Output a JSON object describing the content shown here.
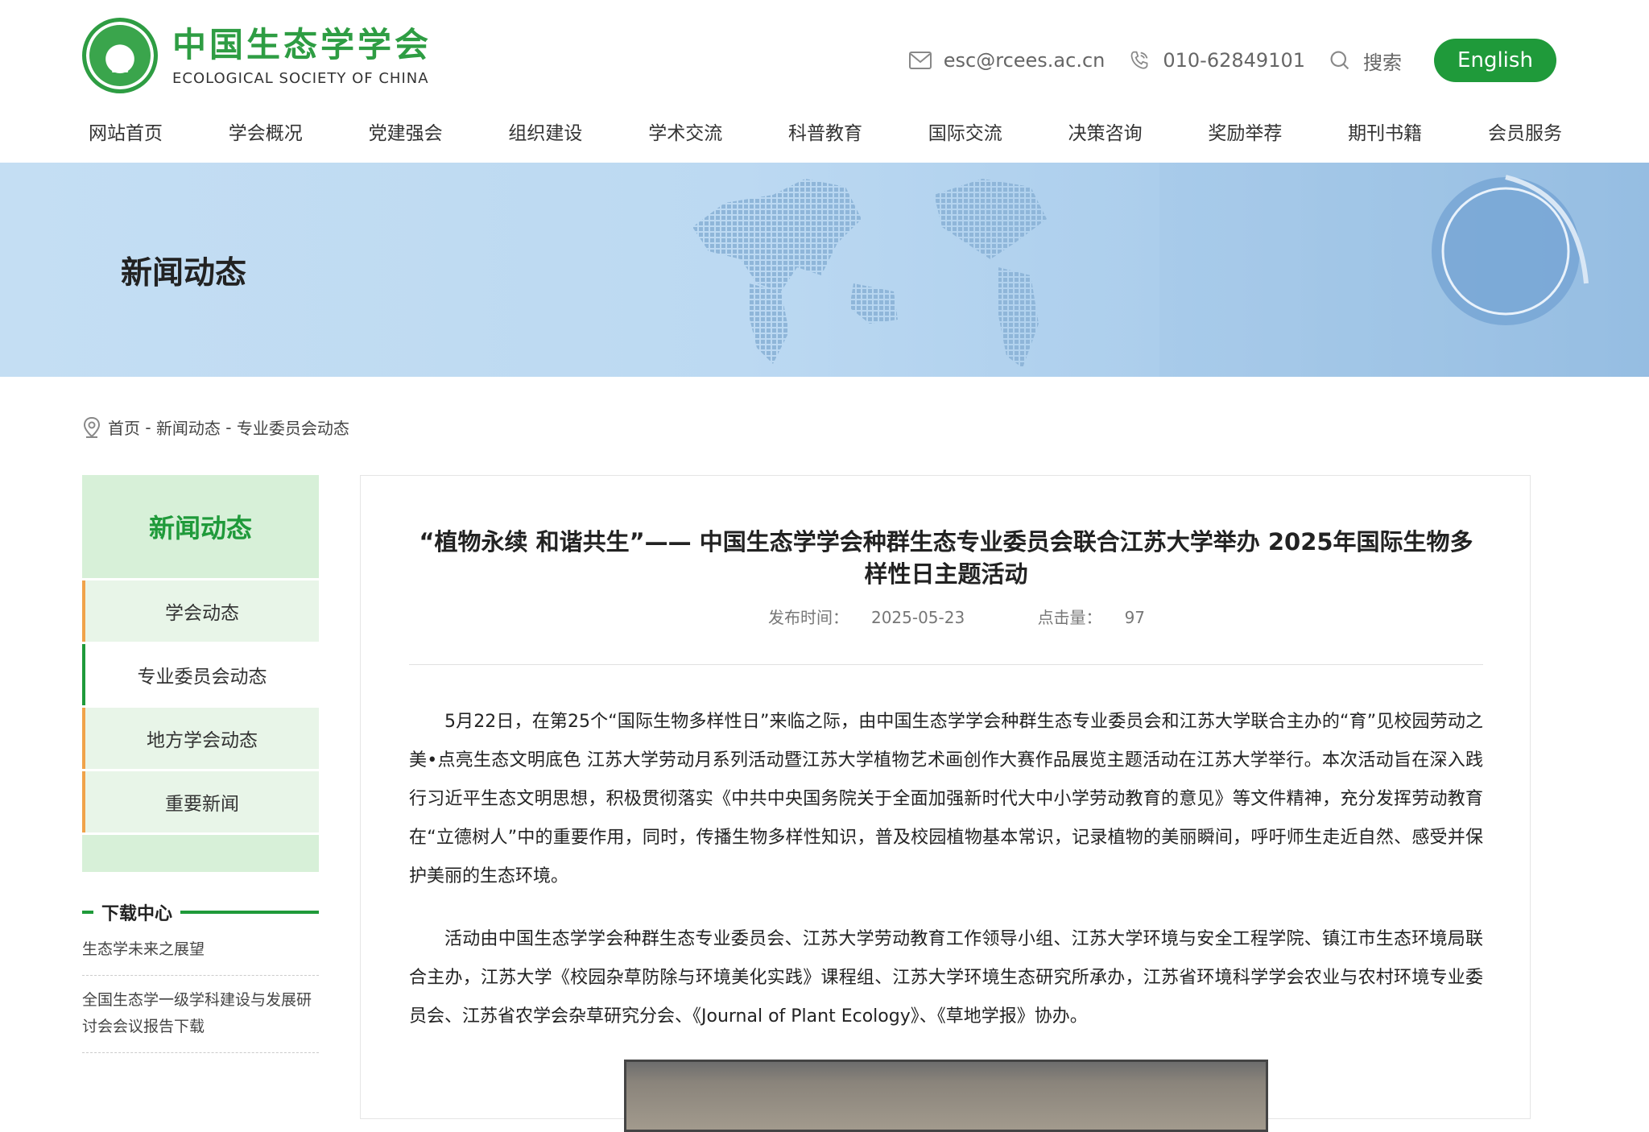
{
  "header": {
    "logo_cn": "中国生态学学会",
    "logo_en": "ECOLOGICAL SOCIETY OF CHINA",
    "logo_badge": "ESC",
    "email": "esc@rcees.ac.cn",
    "phone": "010-62849101",
    "search_label": "搜索",
    "english_label": "English",
    "accent_color": "#1f9a3a"
  },
  "nav": [
    "网站首页",
    "学会概况",
    "党建强会",
    "组织建设",
    "学术交流",
    "科普教育",
    "国际交流",
    "决策咨询",
    "奖励举荐",
    "期刊书籍",
    "会员服务"
  ],
  "banner": {
    "title": "新闻动态"
  },
  "breadcrumb": {
    "home": "首页",
    "sep": " - ",
    "level1": "新闻动态",
    "level2": "专业委员会动态"
  },
  "sidebar": {
    "title": "新闻动态",
    "items": [
      "学会动态",
      "专业委员会动态",
      "地方学会动态",
      "重要新闻"
    ],
    "active_item": "专业委员会动态",
    "download_title": "下载中心",
    "downloads": [
      "生态学未来之展望",
      "全国生态学一级学科建设与发展研讨会会议报告下载"
    ]
  },
  "article": {
    "title": "“植物永续 和谐共生”—— 中国生态学学会种群生态专业委员会联合江苏大学举办 2025年国际生物多样性日主题活动",
    "publish_label": "发布时间：",
    "publish_date": "2025-05-23",
    "hits_label": "点击量：",
    "hits": "97",
    "paragraphs": [
      "5月22日，在第25个“国际生物多样性日”来临之际，由中国生态学学会种群生态专业委员会和江苏大学联合主办的“育”见校园劳动之美•点亮生态文明底色 江苏大学劳动月系列活动暨江苏大学植物艺术画创作大赛作品展览主题活动在江苏大学举行。本次活动旨在深入践行习近平生态文明思想，积极贯彻落实《中共中央国务院关于全面加强新时代大中小学劳动教育的意见》等文件精神，充分发挥劳动教育在“立德树人”中的重要作用，同时，传播生物多样性知识，普及校园植物基本常识，记录植物的美丽瞬间，呼吁师生走近自然、感受并保护美丽的生态环境。",
      "活动由中国生态学学会种群生态专业委员会、江苏大学劳动教育工作领导小组、江苏大学环境与安全工程学院、镇江市生态环境局联合主办，江苏大学《校园杂草防除与环境美化实践》课程组、江苏大学环境生态研究所承办，江苏省环境科学学会农业与农村环境专业委员会、江苏省农学会杂草研究分会、《Journal of Plant Ecology》、《草地学报》协办。"
    ]
  }
}
